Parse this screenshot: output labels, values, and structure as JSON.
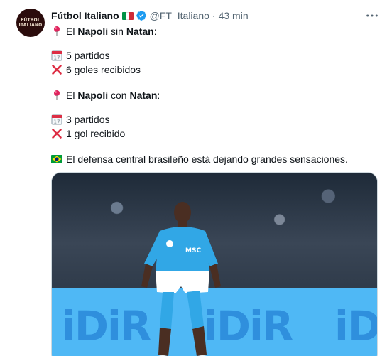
{
  "author": {
    "name": "Fútbol Italiano",
    "handle": "@FT_Italiano",
    "separator": "·",
    "time": "43 min",
    "avatar_text_1": "FÚTBOL",
    "avatar_text_2": "ITALIANO",
    "flag_colors": [
      "#009246",
      "#ffffff",
      "#ce2b37"
    ],
    "verified_color": "#1d9bf0"
  },
  "tweet": {
    "l1_pre": "El ",
    "l1_b1": "Napoli",
    "l1_mid": " sin ",
    "l1_b2": "Natan",
    "l1_post": ":",
    "l2": "5 partidos",
    "l3": "6 goles recibidos",
    "l4_pre": "El ",
    "l4_b1": "Napoli",
    "l4_mid": " con ",
    "l4_b2": "Natan",
    "l4_post": ":",
    "l5": "3 partidos",
    "l6": "1 gol recibido",
    "l7": "El defensa central brasileño está dejando grandes sensaciones.",
    "calendar_day": "17"
  },
  "media": {
    "board_text": "iDiR",
    "shirt_sponsor": "MSC"
  }
}
